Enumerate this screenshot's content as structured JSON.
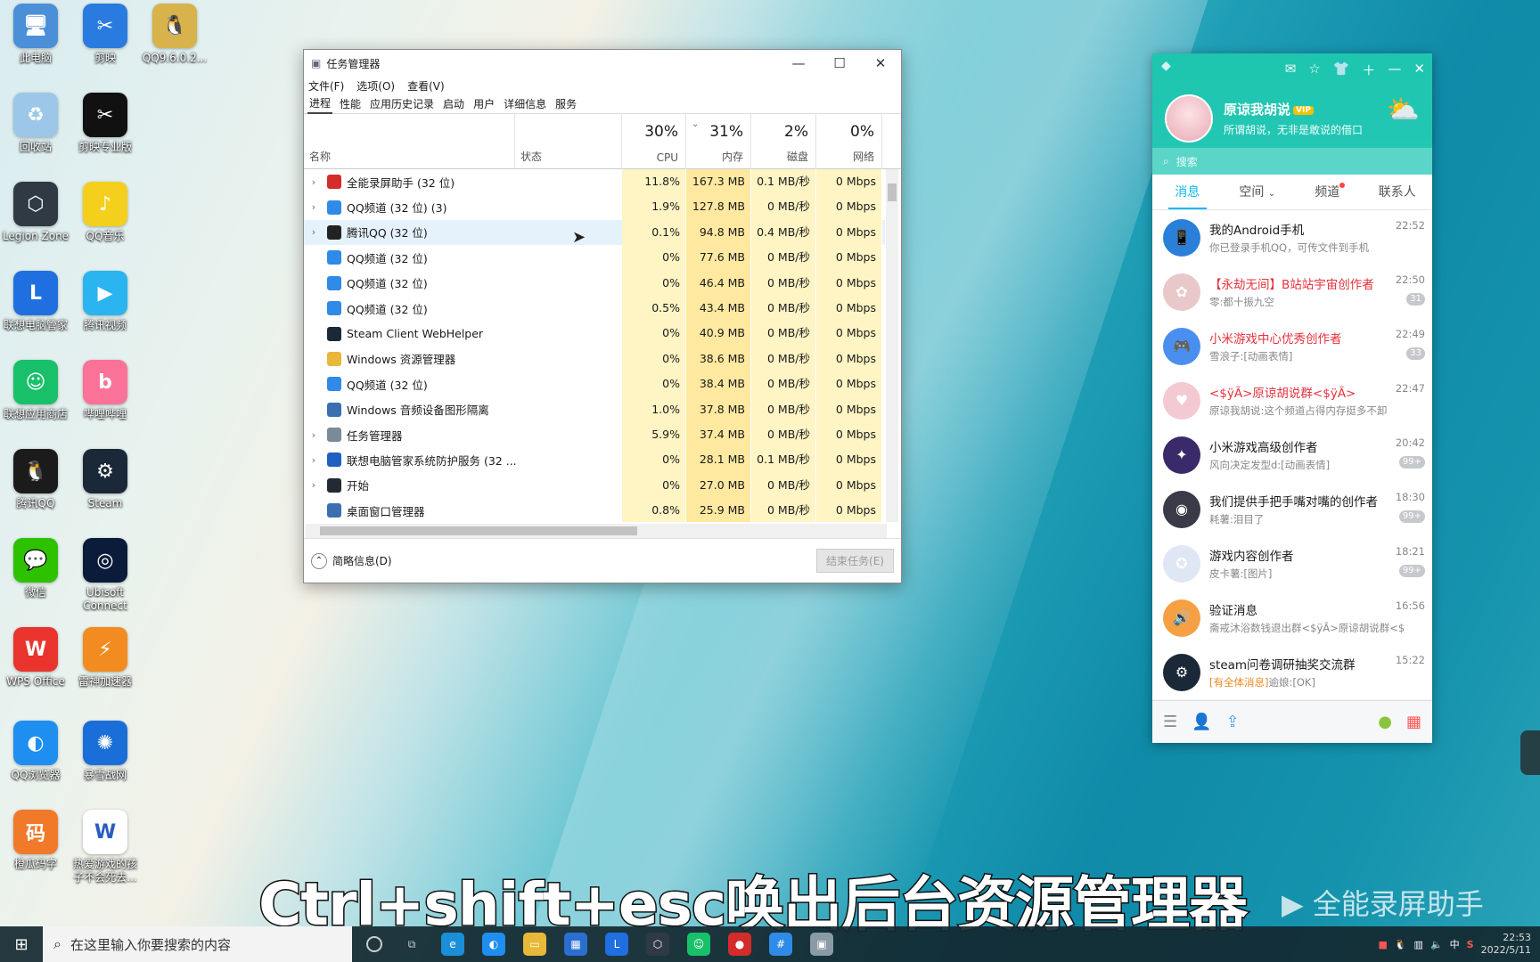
{
  "desktop_icons": [
    {
      "label": "此电脑",
      "icon": "computer-icon",
      "color": "#4a8fd8",
      "glyph": "🖥"
    },
    {
      "label": "剪映",
      "icon": "jianying-icon",
      "color": "#2a7be0",
      "glyph": "✂"
    },
    {
      "label": "QQ9.6.0.2...",
      "icon": "qq-installer-icon",
      "color": "#d8b24a",
      "glyph": "🐧"
    },
    {
      "label": "回收站",
      "icon": "recycle-bin-icon",
      "color": "#9cc7e8",
      "glyph": "♻"
    },
    {
      "label": "剪映专业版",
      "icon": "jianying-pro-icon",
      "color": "#111111",
      "glyph": "✂"
    },
    {
      "label": "Legion Zone",
      "icon": "legion-zone-icon",
      "color": "#2f3a44",
      "glyph": "⬡"
    },
    {
      "label": "QQ音乐",
      "icon": "qq-music-icon",
      "color": "#f4cf1c",
      "glyph": "♪"
    },
    {
      "label": "联想电脑管家",
      "icon": "lenovo-manager-icon",
      "color": "#1f6fe0",
      "glyph": "L"
    },
    {
      "label": "腾讯视频",
      "icon": "tencent-video-icon",
      "color": "#2ab4f0",
      "glyph": "▶"
    },
    {
      "label": "联想应用商店",
      "icon": "lenovo-store-icon",
      "color": "#19c06a",
      "glyph": "☺"
    },
    {
      "label": "哔哩哔哩",
      "icon": "bilibili-icon",
      "color": "#fb7299",
      "glyph": "b"
    },
    {
      "label": "腾讯QQ",
      "icon": "tencent-qq-icon",
      "color": "#1b1b1b",
      "glyph": "🐧"
    },
    {
      "label": "Steam",
      "icon": "steam-icon",
      "color": "#1b2838",
      "glyph": "⚙"
    },
    {
      "label": "微信",
      "icon": "wechat-icon",
      "color": "#2dc100",
      "glyph": "💬"
    },
    {
      "label": "Ubisoft Connect",
      "icon": "ubisoft-icon",
      "color": "#0b1b3a",
      "glyph": "◎"
    },
    {
      "label": "WPS Office",
      "icon": "wps-icon",
      "color": "#e8342d",
      "glyph": "W"
    },
    {
      "label": "雷神加速器",
      "icon": "leishen-icon",
      "color": "#f28b20",
      "glyph": "⚡"
    },
    {
      "label": "QQ浏览器",
      "icon": "qq-browser-icon",
      "color": "#1f8ef1",
      "glyph": "◐"
    },
    {
      "label": "暴雪战网",
      "icon": "battlenet-icon",
      "color": "#1a6ed8",
      "glyph": "✺"
    },
    {
      "label": "橙瓜码字",
      "icon": "chenggua-icon",
      "color": "#f07a2a",
      "glyph": "码"
    },
    {
      "label": "热爱游戏的孩子不会死去...",
      "icon": "word-doc-icon",
      "color": "#ffffff",
      "glyph": "W"
    }
  ],
  "task_manager": {
    "title": "任务管理器",
    "menu": [
      "文件(F)",
      "选项(O)",
      "查看(V)"
    ],
    "tabs": [
      "进程",
      "性能",
      "应用历史记录",
      "启动",
      "用户",
      "详细信息",
      "服务"
    ],
    "headers": {
      "name": "名称",
      "status": "状态",
      "cpu_pct": "30%",
      "cpu": "CPU",
      "mem_pct": "31%",
      "mem": "内存",
      "disk_pct": "2%",
      "disk": "磁盘",
      "net_pct": "0%",
      "net": "网络"
    },
    "rows": [
      {
        "exp": "›",
        "name": "全能录屏助手 (32 位)",
        "icon_color": "#d42b2b",
        "cpu": "11.8%",
        "mem": "167.3 MB",
        "disk": "0.1 MB/秒",
        "net": "0 Mbps"
      },
      {
        "exp": "›",
        "name": "QQ频道 (32 位) (3)",
        "icon_color": "#2f8ae8",
        "cpu": "1.9%",
        "mem": "127.8 MB",
        "disk": "0 MB/秒",
        "net": "0 Mbps"
      },
      {
        "exp": "›",
        "name": "腾讯QQ (32 位)",
        "icon_color": "#222222",
        "cpu": "0.1%",
        "mem": "94.8 MB",
        "disk": "0.4 MB/秒",
        "net": "0 Mbps"
      },
      {
        "exp": "",
        "name": "QQ频道 (32 位)",
        "icon_color": "#2f8ae8",
        "cpu": "0%",
        "mem": "77.6 MB",
        "disk": "0 MB/秒",
        "net": "0 Mbps"
      },
      {
        "exp": "",
        "name": "QQ频道 (32 位)",
        "icon_color": "#2f8ae8",
        "cpu": "0%",
        "mem": "46.4 MB",
        "disk": "0 MB/秒",
        "net": "0 Mbps"
      },
      {
        "exp": "",
        "name": "QQ频道 (32 位)",
        "icon_color": "#2f8ae8",
        "cpu": "0.5%",
        "mem": "43.4 MB",
        "disk": "0 MB/秒",
        "net": "0 Mbps"
      },
      {
        "exp": "",
        "name": "Steam Client WebHelper",
        "icon_color": "#1b2838",
        "cpu": "0%",
        "mem": "40.9 MB",
        "disk": "0 MB/秒",
        "net": "0 Mbps"
      },
      {
        "exp": "",
        "name": "Windows 资源管理器",
        "icon_color": "#e8b838",
        "cpu": "0%",
        "mem": "38.6 MB",
        "disk": "0 MB/秒",
        "net": "0 Mbps"
      },
      {
        "exp": "",
        "name": "QQ频道 (32 位)",
        "icon_color": "#2f8ae8",
        "cpu": "0%",
        "mem": "38.4 MB",
        "disk": "0 MB/秒",
        "net": "0 Mbps"
      },
      {
        "exp": "",
        "name": "Windows 音频设备图形隔离",
        "icon_color": "#3a6fb0",
        "cpu": "1.0%",
        "mem": "37.8 MB",
        "disk": "0 MB/秒",
        "net": "0 Mbps"
      },
      {
        "exp": "›",
        "name": "任务管理器",
        "icon_color": "#7a8a96",
        "cpu": "5.9%",
        "mem": "37.4 MB",
        "disk": "0 MB/秒",
        "net": "0 Mbps"
      },
      {
        "exp": "›",
        "name": "联想电脑管家系统防护服务 (32 ...",
        "icon_color": "#1f5fc0",
        "cpu": "0%",
        "mem": "28.1 MB",
        "disk": "0.1 MB/秒",
        "net": "0 Mbps"
      },
      {
        "exp": "›",
        "name": "开始",
        "icon_color": "#222a33",
        "cpu": "0%",
        "mem": "27.0 MB",
        "disk": "0 MB/秒",
        "net": "0 Mbps"
      },
      {
        "exp": "",
        "name": "桌面窗口管理器",
        "icon_color": "#3a6fb0",
        "cpu": "0.8%",
        "mem": "25.9 MB",
        "disk": "0 MB/秒",
        "net": "0 Mbps"
      }
    ],
    "selected_row": 2,
    "footer": {
      "brief": "简略信息(D)",
      "end_task": "结束任务(E)"
    }
  },
  "qq": {
    "nickname": "原谅我胡说",
    "vip": "VIP",
    "signature": "所谓胡说，无非是敢说的借口",
    "search_placeholder": "搜索",
    "tabs": [
      "消息",
      "空间",
      "频道",
      "联系人"
    ],
    "conversations": [
      {
        "name": "我的Android手机",
        "preview": "你已登录手机QQ，可传文件到手机",
        "time": "22:52",
        "badge": "",
        "red": false,
        "color": "#2a7fd8",
        "glyph": "📱"
      },
      {
        "name": "【永劫无间】B站站宇宙创作者",
        "preview": "零:都十振九空",
        "time": "22:50",
        "badge": "31",
        "red": true,
        "color": "#e8c8c8",
        "glyph": "✿"
      },
      {
        "name": "小米游戏中心优秀创作者",
        "preview": "雪浪子:[动画表情]",
        "time": "22:49",
        "badge": "33",
        "red": true,
        "color": "#4a8ff0",
        "glyph": "🎮"
      },
      {
        "name": "<$ÿÃ>原谅胡说群<$ÿÃ>",
        "preview": "原谅我胡说:这个频道占得内存挺多不卸",
        "time": "22:47",
        "badge": "",
        "red": true,
        "color": "#f3c9d2",
        "glyph": "♥"
      },
      {
        "name": "小米游戏高级创作者",
        "preview": "风向决定发型d:[动画表情]",
        "time": "20:42",
        "badge": "99+",
        "red": false,
        "color": "#3a2a6a",
        "glyph": "✦"
      },
      {
        "name": "我们提供手把手嘴对嘴的创作者",
        "preview": "耗薯:泪目了",
        "time": "18:30",
        "badge": "99+",
        "red": false,
        "color": "#3a3a48",
        "glyph": "◉"
      },
      {
        "name": "游戏内容创作者",
        "preview": "皮卡薯:[图片]",
        "time": "18:21",
        "badge": "99+",
        "red": false,
        "color": "#dfe6f4",
        "glyph": "✪"
      },
      {
        "name": "验证消息",
        "preview": "斋戒沐浴数钱退出群<$ÿÃ>原谅胡说群<$",
        "time": "16:56",
        "badge": "",
        "red": false,
        "color": "#f5a043",
        "glyph": "🔊"
      },
      {
        "name": "steam问卷调研抽奖交流群",
        "preview_tag": "[有全体消息]",
        "preview": "逾娘:[OK]",
        "time": "15:22",
        "badge": "",
        "red": false,
        "color": "#1b2838",
        "glyph": "⚙"
      }
    ]
  },
  "subtitle": "Ctrl+shift+esc唤出后台资源管理器",
  "watermark": "全能录屏助手",
  "taskbar": {
    "search_placeholder": "在这里输入你要搜索的内容",
    "time": "22:53",
    "date": "2022/5/11",
    "ime": "中"
  }
}
